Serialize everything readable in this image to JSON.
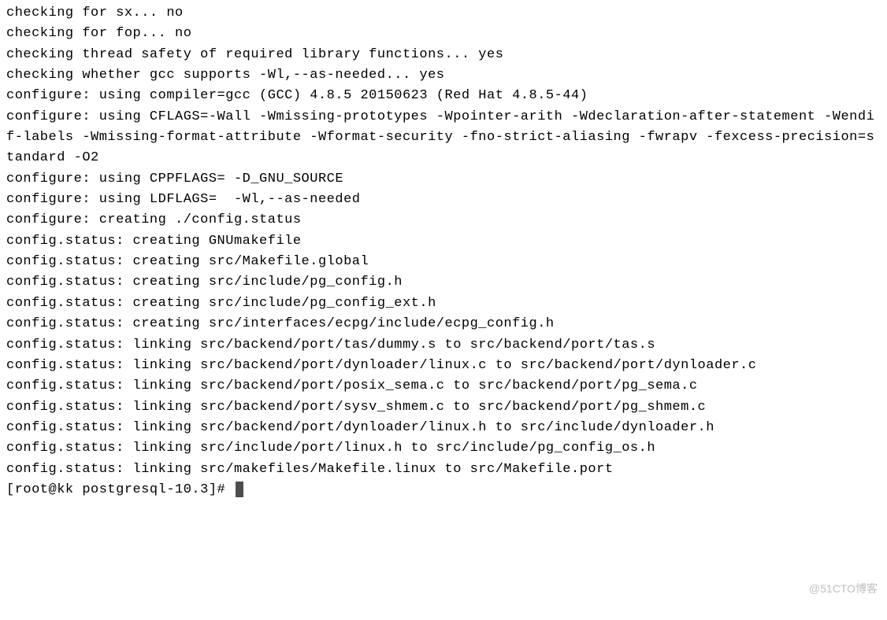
{
  "terminal": {
    "lines": [
      "checking for sx... no",
      "checking for fop... no",
      "checking thread safety of required library functions... yes",
      "checking whether gcc supports -Wl,--as-needed... yes",
      "configure: using compiler=gcc (GCC) 4.8.5 20150623 (Red Hat 4.8.5-44)",
      "configure: using CFLAGS=-Wall -Wmissing-prototypes -Wpointer-arith -Wdeclaration-after-statement -Wendif-labels -Wmissing-format-attribute -Wformat-security -fno-strict-aliasing -fwrapv -fexcess-precision=standard -O2",
      "configure: using CPPFLAGS= -D_GNU_SOURCE",
      "configure: using LDFLAGS=  -Wl,--as-needed",
      "configure: creating ./config.status",
      "config.status: creating GNUmakefile",
      "config.status: creating src/Makefile.global",
      "config.status: creating src/include/pg_config.h",
      "config.status: creating src/include/pg_config_ext.h",
      "config.status: creating src/interfaces/ecpg/include/ecpg_config.h",
      "config.status: linking src/backend/port/tas/dummy.s to src/backend/port/tas.s",
      "config.status: linking src/backend/port/dynloader/linux.c to src/backend/port/dynloader.c",
      "config.status: linking src/backend/port/posix_sema.c to src/backend/port/pg_sema.c",
      "config.status: linking src/backend/port/sysv_shmem.c to src/backend/port/pg_shmem.c",
      "config.status: linking src/backend/port/dynloader/linux.h to src/include/dynloader.h",
      "config.status: linking src/include/port/linux.h to src/include/pg_config_os.h",
      "config.status: linking src/makefiles/Makefile.linux to src/Makefile.port"
    ],
    "prompt": "[root@kk postgresql-10.3]# "
  },
  "watermark": "@51CTO博客"
}
